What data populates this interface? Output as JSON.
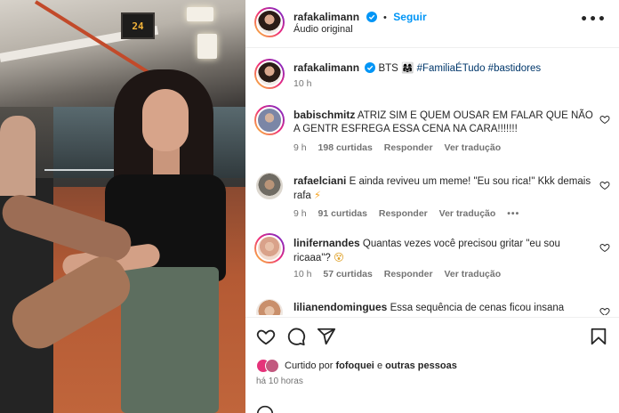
{
  "video": {
    "scoreboard_text": "24"
  },
  "header": {
    "username": "rafakalimann",
    "follow_label": "Seguir",
    "separator": "•",
    "audio_label": "Áudio original",
    "more_icon": "more-horizontal-icon"
  },
  "caption": {
    "username": "rafakalimann",
    "text": "BTS",
    "emoji": "👩‍👩‍👧",
    "hashtags": "#FamiliaÉTudo #bastidores",
    "time": "10 h"
  },
  "comments": [
    {
      "username": "babischmitz",
      "text": "ATRIZ SIM E QUEM OUSAR EM FALAR QUE NÃO A GENTR ESFREGA ESSA CENA NA CARA!!!!!!!",
      "time": "9 h",
      "likes": "198 curtidas",
      "reply": "Responder",
      "translate": "Ver tradução",
      "avatar_color": "#7b86a6"
    },
    {
      "username": "rafaelciani",
      "text": "E ainda reviveu um meme! \"Eu sou rica!\" Kkk demais rafa",
      "emoji": "⚡",
      "time": "9 h",
      "likes": "91 curtidas",
      "reply": "Responder",
      "translate": "Ver tradução",
      "more": "•••",
      "avatar_color": "#6f6b63"
    },
    {
      "username": "linifernandes",
      "text": "Quantas vezes você precisou gritar \"eu sou ricaaa\"?",
      "emoji": "😵",
      "time": "10 h",
      "likes": "57 curtidas",
      "reply": "Responder",
      "translate": "Ver tradução",
      "avatar_color": "#d9a28a"
    },
    {
      "username": "lilianendomingues",
      "text": "Essa sequência de cenas ficou insana",
      "avatar_color": "#c98f6b"
    }
  ],
  "actions": {
    "liked_by_prefix": "Curtido por",
    "liked_by_user": "fofoquei",
    "liked_by_conj": "e",
    "liked_by_others": "outras pessoas",
    "time_ago": "há 10 horas"
  },
  "colors": {
    "accent": "#0095f6",
    "verified": "#0095f6",
    "hashtag": "#00376b",
    "text": "#262626",
    "muted": "#737373"
  },
  "icons": {
    "like": "heart-icon",
    "comment": "comment-icon",
    "share": "send-icon",
    "save": "bookmark-icon",
    "verified": "verified-badge-icon"
  }
}
